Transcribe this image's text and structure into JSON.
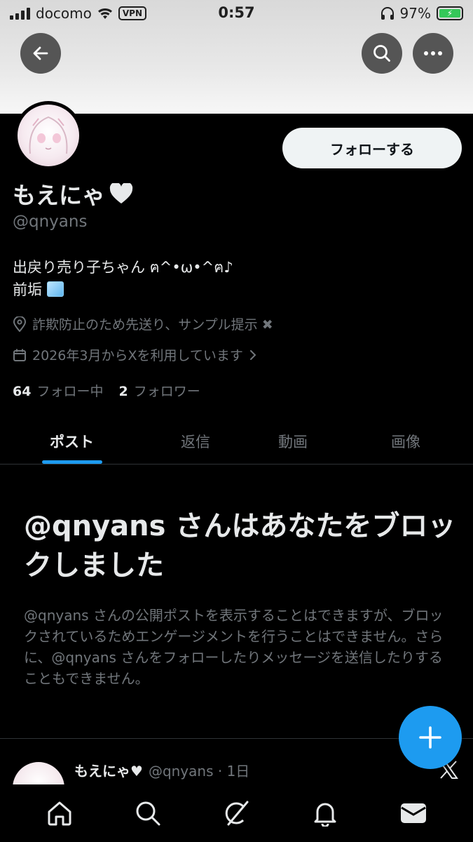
{
  "status_bar": {
    "carrier": "docomo",
    "vpn": "VPN",
    "time": "0:57",
    "battery": "97%"
  },
  "profile": {
    "follow_label": "フォローする",
    "display_name": "もえにゃ",
    "handle": "@qnyans",
    "bio_line1": "出戻り売り子ちゃん ฅ^•ω•^ฅ♪",
    "bio_line2": "前垢",
    "location": "詐欺防止のため先送り、サンプル提示 ✖",
    "joined": "2026年3月からXを利用しています",
    "following_count": "64",
    "following_label": "フォロー中",
    "followers_count": "2",
    "followers_label": "フォロワー"
  },
  "tabs": [
    {
      "label": "ポスト"
    },
    {
      "label": "返信"
    },
    {
      "label": "動画"
    },
    {
      "label": "画像"
    }
  ],
  "blocked": {
    "title": "@qnyans さんはあなたをブロックしました",
    "body": "@qnyans さんの公開ポストを表示することはできますが、ブロックされているためエンゲージメントを行うことはできません。さらに、@qnyans さんをフォローしたりメッセージを送信したりすることもできません。"
  },
  "post": {
    "name": "もえにゃ♥",
    "handle": "@qnyans · 1日"
  },
  "icons": {
    "back": "back-arrow-icon",
    "search": "search-icon",
    "more": "more-icon",
    "compose": "plus-icon",
    "nav": [
      "home-icon",
      "search-icon",
      "grok-icon",
      "bell-icon",
      "mail-icon"
    ]
  },
  "colors": {
    "accent": "#1d9bf0",
    "muted": "#71767b",
    "text": "#e7e9ea"
  }
}
